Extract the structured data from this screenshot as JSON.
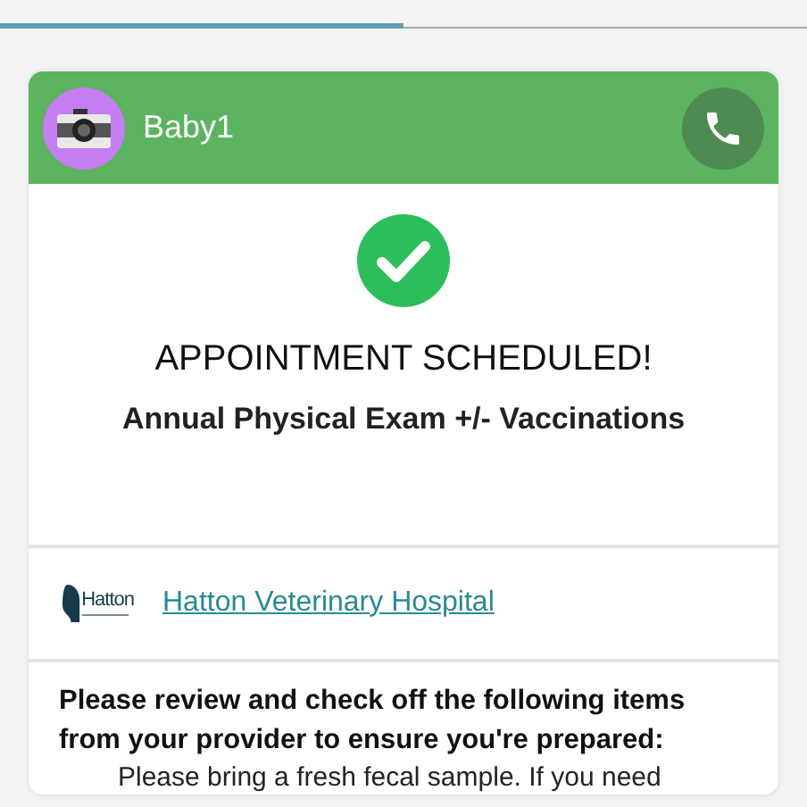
{
  "tabs": [
    {
      "selected": true
    },
    {
      "selected": false
    }
  ],
  "patient": {
    "name": "Baby1"
  },
  "confirmation": {
    "title": "APPOINTMENT SCHEDULED!",
    "service": "Annual Physical Exam +/- Vaccinations"
  },
  "provider": {
    "logo_text": "Hatton",
    "name": "Hatton Veterinary Hospital"
  },
  "checklist": {
    "intro": "Please review and check off the following items from your provider to ensure you're prepared:",
    "items": [
      "Please bring a fresh fecal sample.  If you need"
    ]
  }
}
